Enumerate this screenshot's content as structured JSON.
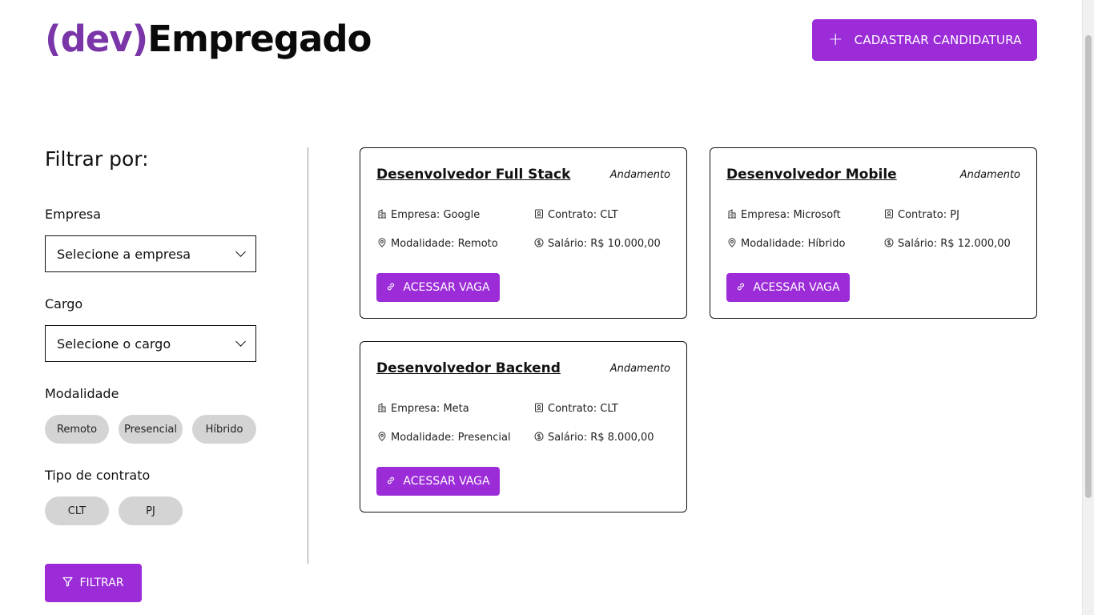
{
  "header": {
    "logo_paren": "(dev)",
    "logo_main": "Empregado",
    "cta_icon": "plus-icon",
    "cta_label": "CADASTRAR CANDIDATURA"
  },
  "sidebar": {
    "title": "Filtrar por:",
    "company": {
      "label": "Empresa",
      "value": "Selecione a empresa"
    },
    "role": {
      "label": "Cargo",
      "value": "Selecione o cargo"
    },
    "modality": {
      "label": "Modalidade",
      "options": [
        "Remoto",
        "Presencial",
        "Híbrido"
      ]
    },
    "contract": {
      "label": "Tipo de contrato",
      "options": [
        "CLT",
        "PJ"
      ]
    },
    "filter_button": "FILTRAR"
  },
  "jobs": [
    {
      "title": "Desenvolvedor Full Stack",
      "status": "Andamento",
      "company": "Empresa: Google",
      "contract": "Contrato: CLT",
      "modality": "Modalidade: Remoto",
      "salary": "Salário: R$ 10.000,00",
      "button": "ACESSAR VAGA"
    },
    {
      "title": "Desenvolvedor Mobile",
      "status": "Andamento",
      "company": "Empresa: Microsoft",
      "contract": "Contrato: PJ",
      "modality": "Modalidade: Híbrido",
      "salary": "Salário: R$ 12.000,00",
      "button": "ACESSAR VAGA"
    },
    {
      "title": "Desenvolvedor Backend",
      "status": "Andamento",
      "company": "Empresa: Meta",
      "contract": "Contrato: CLT",
      "modality": "Modalidade: Presencial",
      "salary": "Salário: R$ 8.000,00",
      "button": "ACESSAR VAGA"
    }
  ],
  "colors": {
    "accent": "#9b2cd8",
    "logo_paren": "#7a35a8",
    "chip_bg": "#d4d4d4"
  }
}
